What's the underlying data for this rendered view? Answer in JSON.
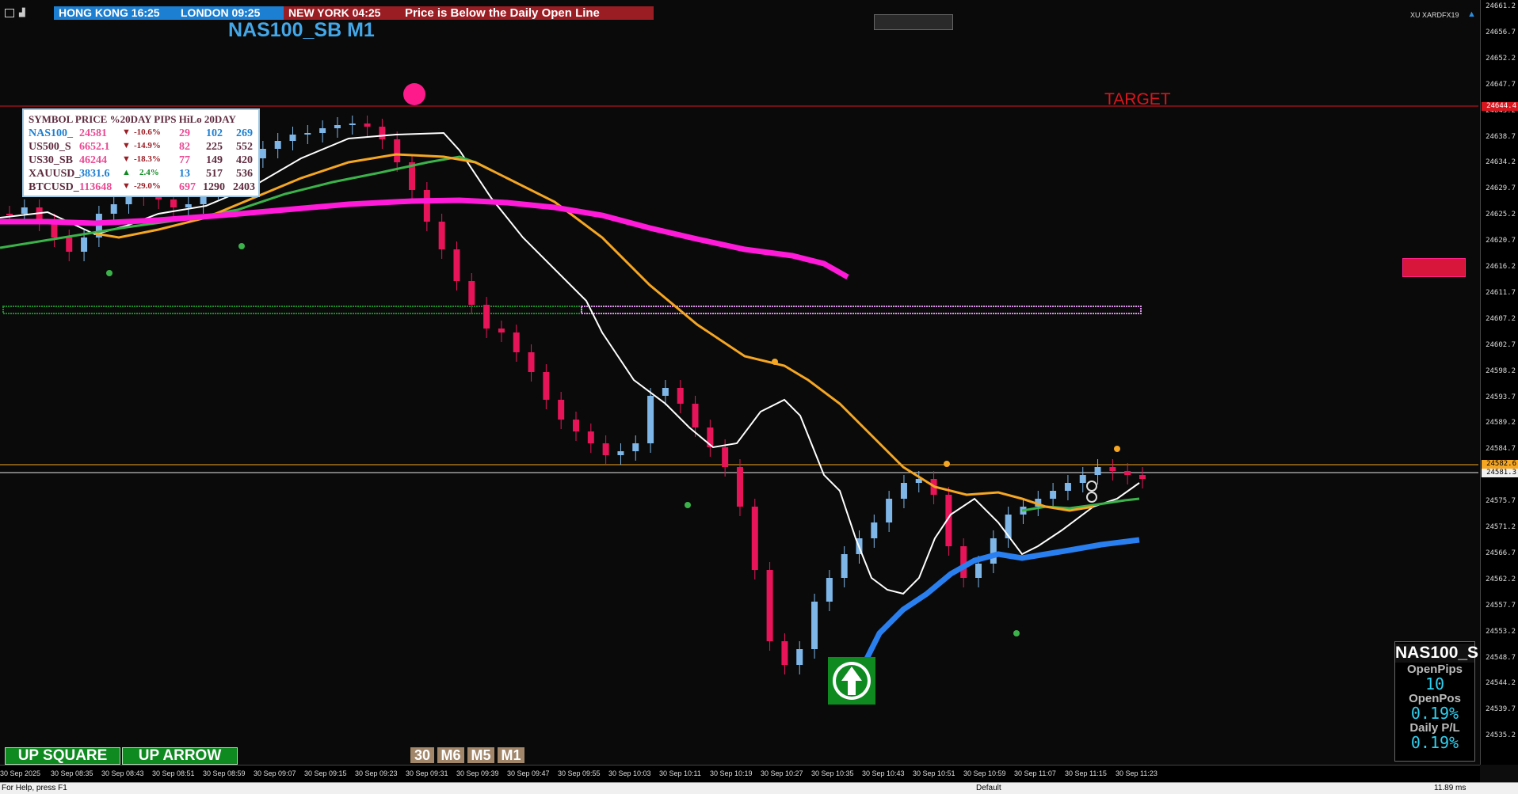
{
  "clocks": [
    {
      "label": "HONG KONG 16:25",
      "bg": "#1c7fd1"
    },
    {
      "label": "LONDON 09:25",
      "bg": "#1c7fd1"
    },
    {
      "label": "NEW YORK 04:25",
      "bg": "#9a1d24"
    }
  ],
  "alert": "Price is Below the Daily Open Line",
  "symbol_title": "NAS100_SB M1",
  "broker_label": "XU XARDFX19",
  "target_label": "TARGET",
  "colors": {
    "bull": "#7fb6e8",
    "bear": "#e8145a",
    "neutral": "#555555",
    "ema_white": "#ffffff",
    "ema_green": "#3bb34a",
    "ema_orange": "#f5a623",
    "ema_magenta": "#ff1ad9",
    "ema_blue": "#2a7ff0",
    "accent_target": "#d8161e"
  },
  "table": {
    "header": "SYMBOL PRICE %20DAY PIPS HiLo 20DAY",
    "rows": [
      {
        "sym": "NAS100_",
        "price": "24581",
        "dir": "▼",
        "pct": "-10.6%",
        "pips": "29",
        "hilo": "102",
        "day20": "269"
      },
      {
        "sym": "US500_S",
        "price": "6652.1",
        "dir": "▼",
        "pct": "-14.9%",
        "pips": "82",
        "hilo": "225",
        "day20": "552"
      },
      {
        "sym": "US30_SB",
        "price": "46244",
        "dir": "▼",
        "pct": "-18.3%",
        "pips": "77",
        "hilo": "149",
        "day20": "420"
      },
      {
        "sym": "XAUUSD_",
        "price": "3831.6",
        "dir": "▲",
        "pct": "2.4%",
        "pips": "13",
        "hilo": "517",
        "day20": "536"
      },
      {
        "sym": "BTCUSD_",
        "price": "113648",
        "dir": "▼",
        "pct": "-29.0%",
        "pips": "697",
        "hilo": "1290",
        "day20": "2403"
      }
    ]
  },
  "price_axis": {
    "labels": [
      "24661.2",
      "24656.7",
      "24652.2",
      "24647.7",
      "24643.2",
      "24638.7",
      "24634.2",
      "24629.7",
      "24625.2",
      "24620.7",
      "24616.2",
      "24611.7",
      "24607.2",
      "24602.7",
      "24598.2",
      "24593.7",
      "24589.2",
      "24584.7",
      "24580.2",
      "24575.7",
      "24571.2",
      "24566.7",
      "24562.2",
      "24557.7",
      "24553.2",
      "24548.7",
      "24544.2",
      "24539.7",
      "24535.2"
    ],
    "target_tag": "24644.4",
    "orange_tag": "24582.6",
    "white_tag": "24581.3"
  },
  "time_axis": {
    "labels": [
      "30 Sep 2025",
      "30 Sep 08:35",
      "30 Sep 08:43",
      "30 Sep 08:51",
      "30 Sep 08:59",
      "30 Sep 09:07",
      "30 Sep 09:15",
      "30 Sep 09:23",
      "30 Sep 09:31",
      "30 Sep 09:39",
      "30 Sep 09:47",
      "30 Sep 09:55",
      "30 Sep 10:03",
      "30 Sep 10:11",
      "30 Sep 10:19",
      "30 Sep 10:27",
      "30 Sep 10:35",
      "30 Sep 10:43",
      "30 Sep 10:51",
      "30 Sep 10:59",
      "30 Sep 11:07",
      "30 Sep 11:15",
      "30 Sep 11:23"
    ]
  },
  "buttons": {
    "up_square": "UP SQUARE",
    "up_arrow": "UP ARROW"
  },
  "timeframes": [
    "30",
    "M6",
    "M5",
    "M1"
  ],
  "info_panel": {
    "symbol": "NAS100_S",
    "open_pips_label": "OpenPips",
    "open_pips_value": "10",
    "open_pos_label": "OpenPos",
    "open_pos_value": "0.19%",
    "daily_label": "Daily P/L",
    "daily_value": "0.19%"
  },
  "status": {
    "left": "For Help, press F1",
    "mid": "Default",
    "right": "11.89 ms"
  }
}
